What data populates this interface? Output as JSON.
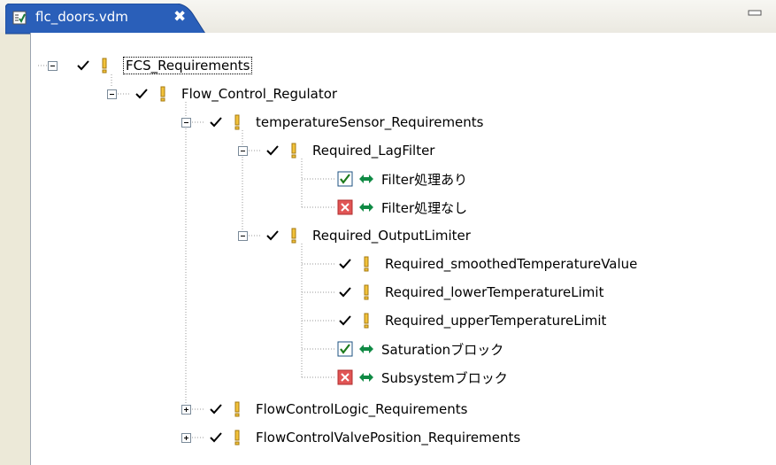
{
  "editor_tab": {
    "title": "flc_doors.vdm",
    "close": "✖"
  },
  "tree": {
    "root": "FCS_Requirements",
    "flow_control_regulator": "Flow_Control_Regulator",
    "temperature_sensor": "temperatureSensor_Requirements",
    "required_lagfilter": "Required_LagFilter",
    "filter_yes": "Filter処理あり",
    "filter_no": "Filter処理なし",
    "required_output_limiter": "Required_OutputLimiter",
    "req_smoothed": "Required_smoothedTemperatureValue",
    "req_lower": "Required_lowerTemperatureLimit",
    "req_upper": "Required_upperTemperatureLimit",
    "saturation_block": "Saturationブロック",
    "subsystem_block": "Subsystemブロック",
    "flow_control_logic": "FlowControlLogic_Requirements",
    "flow_control_valve": "FlowControlValvePosition_Requirements"
  },
  "colors": {
    "tab_blue": "#2a5fb9",
    "check_mark": "#000000",
    "exclamation": "#d9a21a",
    "arrow_green": "#0f8a44",
    "checkbox_red": "#e15555"
  }
}
